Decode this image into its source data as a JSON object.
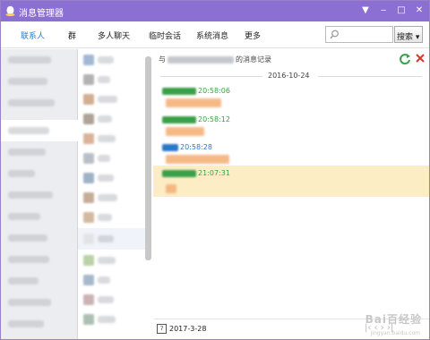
{
  "window": {
    "title": "消息管理器",
    "minimize": "▼",
    "restore": "‒",
    "maximize": "□",
    "close": "✕"
  },
  "tabs": [
    {
      "label": "联系人",
      "active": true
    },
    {
      "label": "群",
      "active": false
    },
    {
      "label": "多人聊天",
      "active": false
    },
    {
      "label": "临时会话",
      "active": false
    },
    {
      "label": "系统消息",
      "active": false
    },
    {
      "label": "更多",
      "active": false
    }
  ],
  "search": {
    "placeholder": "",
    "button": "搜索 ▾"
  },
  "conversation": {
    "prefix": "与",
    "suffix": "的消息记录",
    "date": "2016-10-24",
    "messages": [
      {
        "time": "20:58:06",
        "sender_color": "#3aa049",
        "bubble_frac": 0.2,
        "highlighted": false
      },
      {
        "time": "20:58:12",
        "sender_color": "#3aa049",
        "bubble_frac": 0.14,
        "highlighted": false
      },
      {
        "time": "20:58:28",
        "sender_color": "#2a78c8",
        "bubble_frac": 0.23,
        "highlighted": false
      },
      {
        "time": "21:07:31",
        "sender_color": "#3aa049",
        "bubble_frac": 0.04,
        "highlighted": true
      }
    ]
  },
  "footer": {
    "calendar_day": "7",
    "date": "2017-3-28",
    "pager": "|‹  ‹  ›  ›|"
  },
  "colors": {
    "titlebar": "#8c6fd2",
    "active_tab": "#1f7fd6",
    "highlight": "#fcedc5",
    "refresh_icon": "#3aa049",
    "delete_icon": "#d43c2c"
  },
  "watermark": {
    "text": "Bai百经验",
    "url": "jingyan.baidu.com"
  }
}
